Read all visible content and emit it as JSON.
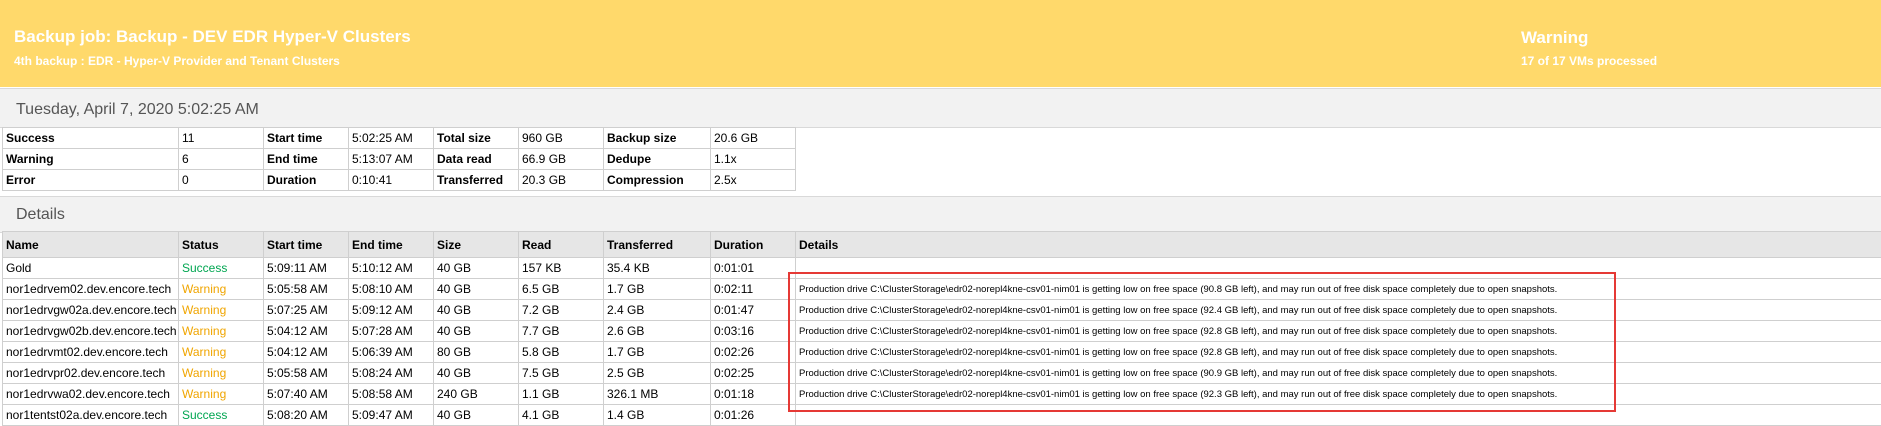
{
  "header": {
    "title": "Backup job: Backup - DEV EDR Hyper-V Clusters",
    "subtitle": "4th backup : EDR - Hyper-V Provider and Tenant Clusters",
    "status": "Warning",
    "vms_processed": "17 of 17 VMs processed",
    "color": "#ffd96b"
  },
  "date": "Tuesday, April 7, 2020 5:02:25 AM",
  "summary": [
    [
      "Success",
      "11",
      "Start time",
      "5:02:25 AM",
      "Total size",
      "960 GB",
      "Backup size",
      "20.6 GB"
    ],
    [
      "Warning",
      "6",
      "End time",
      "5:13:07 AM",
      "Data read",
      "66.9 GB",
      "Dedupe",
      "1.1x"
    ],
    [
      "Error",
      "0",
      "Duration",
      "0:10:41",
      "Transferred",
      "20.3 GB",
      "Compression",
      "2.5x"
    ]
  ],
  "details_heading": "Details",
  "details_columns": [
    "Name",
    "Status",
    "Start time",
    "End time",
    "Size",
    "Read",
    "Transferred",
    "Duration",
    "Details"
  ],
  "rows": [
    {
      "name": "Gold",
      "status": "Success",
      "start": "5:09:11 AM",
      "end": "5:10:12 AM",
      "size": "40 GB",
      "read": "157 KB",
      "transferred": "35.4 KB",
      "duration": "0:01:01",
      "details": ""
    },
    {
      "name": "nor1edrvem02.dev.encore.tech",
      "status": "Warning",
      "start": "5:05:58 AM",
      "end": "5:08:10 AM",
      "size": "40 GB",
      "read": "6.5 GB",
      "transferred": "1.7 GB",
      "duration": "0:02:11",
      "details": "Production drive C:\\ClusterStorage\\edr02-norepl4kne-csv01-nim01 is getting low on free space (90.8 GB left), and may run out of free disk space completely due to open snapshots."
    },
    {
      "name": "nor1edrvgw02a.dev.encore.tech",
      "status": "Warning",
      "start": "5:07:25 AM",
      "end": "5:09:12 AM",
      "size": "40 GB",
      "read": "7.2 GB",
      "transferred": "2.4 GB",
      "duration": "0:01:47",
      "details": "Production drive C:\\ClusterStorage\\edr02-norepl4kne-csv01-nim01 is getting low on free space (92.4 GB left), and may run out of free disk space completely due to open snapshots."
    },
    {
      "name": "nor1edrvgw02b.dev.encore.tech",
      "status": "Warning",
      "start": "5:04:12 AM",
      "end": "5:07:28 AM",
      "size": "40 GB",
      "read": "7.7 GB",
      "transferred": "2.6 GB",
      "duration": "0:03:16",
      "details": "Production drive C:\\ClusterStorage\\edr02-norepl4kne-csv01-nim01 is getting low on free space (92.8 GB left), and may run out of free disk space completely due to open snapshots."
    },
    {
      "name": "nor1edrvmt02.dev.encore.tech",
      "status": "Warning",
      "start": "5:04:12 AM",
      "end": "5:06:39 AM",
      "size": "80 GB",
      "read": "5.8 GB",
      "transferred": "1.7 GB",
      "duration": "0:02:26",
      "details": "Production drive C:\\ClusterStorage\\edr02-norepl4kne-csv01-nim01 is getting low on free space (92.8 GB left), and may run out of free disk space completely due to open snapshots."
    },
    {
      "name": "nor1edrvpr02.dev.encore.tech",
      "status": "Warning",
      "start": "5:05:58 AM",
      "end": "5:08:24 AM",
      "size": "40 GB",
      "read": "7.5 GB",
      "transferred": "2.5 GB",
      "duration": "0:02:25",
      "details": "Production drive C:\\ClusterStorage\\edr02-norepl4kne-csv01-nim01 is getting low on free space (90.9 GB left), and may run out of free disk space completely due to open snapshots."
    },
    {
      "name": "nor1edrvwa02.dev.encore.tech",
      "status": "Warning",
      "start": "5:07:40 AM",
      "end": "5:08:58 AM",
      "size": "240 GB",
      "read": "1.1 GB",
      "transferred": "326.1 MB",
      "duration": "0:01:18",
      "details": "Production drive C:\\ClusterStorage\\edr02-norepl4kne-csv01-nim01 is getting low on free space (92.3 GB left), and may run out of free disk space completely due to open snapshots."
    },
    {
      "name": "nor1tentst02a.dev.encore.tech",
      "status": "Success",
      "start": "5:08:20 AM",
      "end": "5:09:47 AM",
      "size": "40 GB",
      "read": "4.1 GB",
      "transferred": "1.4 GB",
      "duration": "0:01:26",
      "details": ""
    }
  ],
  "colors": {
    "success": "#00a651",
    "warning": "#f0a500",
    "highlight": "#e53935"
  }
}
